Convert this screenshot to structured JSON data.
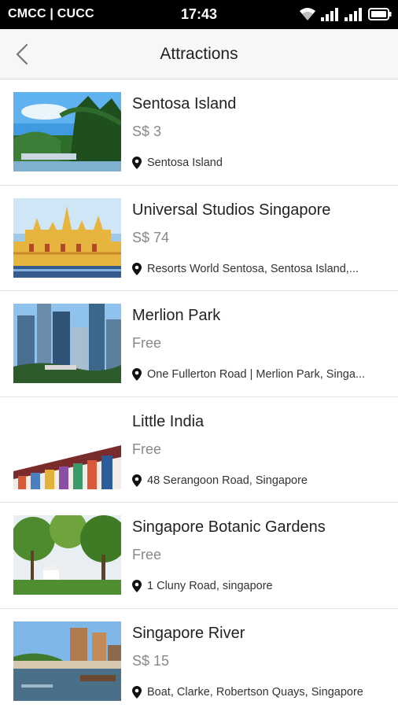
{
  "status_bar": {
    "carrier": "CMCC | CUCC",
    "time": "17:43",
    "icons": [
      "wifi-icon",
      "signal-icon-1",
      "signal-icon-2",
      "battery-icon"
    ]
  },
  "header": {
    "title": "Attractions",
    "back_icon": "chevron-left-icon"
  },
  "attractions": [
    {
      "name": "Sentosa Island",
      "price": "S$ 3",
      "address": "Sentosa Island"
    },
    {
      "name": "Universal Studios Singapore",
      "price": "S$ 74",
      "address": "Resorts World Sentosa, Sentosa Island,..."
    },
    {
      "name": "Merlion Park",
      "price": "Free",
      "address": "One Fullerton Road | Merlion Park, Singa..."
    },
    {
      "name": "Little India",
      "price": "Free",
      "address": "48 Serangoon Road, Singapore"
    },
    {
      "name": "Singapore Botanic Gardens",
      "price": "Free",
      "address": "1 Cluny Road, singapore"
    },
    {
      "name": "Singapore River",
      "price": "S$ 15",
      "address": "Boat, Clarke, Robertson Quays, Singapore"
    }
  ],
  "colors": {
    "status_bar_bg": "#000000",
    "app_bar_bg": "#f7f7f7",
    "price_text": "#888888",
    "divider": "#e3e3e3"
  }
}
